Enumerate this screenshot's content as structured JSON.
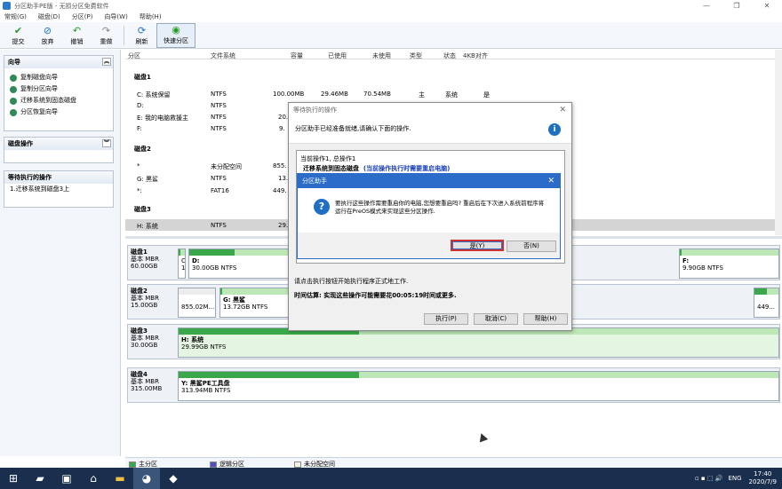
{
  "window": {
    "title": "分区助手PE版 - 无损分区免费软件",
    "controls": [
      "—",
      "❐",
      "✕"
    ]
  },
  "menu": [
    "常规(G)",
    "磁盘(D)",
    "分区(P)",
    "向导(W)",
    "帮助(H)"
  ],
  "toolbar": [
    {
      "label": "提交",
      "icon": "check-icon"
    },
    {
      "label": "放弃",
      "icon": "discard-icon"
    },
    {
      "label": "撤销",
      "icon": "undo-icon"
    },
    {
      "label": "重做",
      "icon": "redo-icon"
    },
    {
      "label": "刷新",
      "icon": "refresh-icon"
    },
    {
      "label": "快速分区",
      "icon": "quick-partition-icon"
    }
  ],
  "sidebar": {
    "wizard": {
      "title": "向导",
      "items": [
        "复制磁盘向导",
        "复制分区向导",
        "迁移系统到固态磁盘",
        "分区恢复向导"
      ]
    },
    "disk_ops": {
      "title": "磁盘操作"
    },
    "pending": {
      "title": "等待执行的操作",
      "items": [
        "1.迁移系统到磁盘3上"
      ]
    }
  },
  "columns": [
    "分区",
    "文件系统",
    "容量",
    "已使用",
    "未使用",
    "类型",
    "状态",
    "4KB对齐"
  ],
  "disks": [
    {
      "name": "磁盘1",
      "rows": [
        {
          "part": "C: 系统保留",
          "fs": "NTFS",
          "cap": "100.00MB",
          "used": "29.46MB",
          "free": "70.54MB",
          "type": "主",
          "status": "系统",
          "align": "是"
        },
        {
          "part": "D:",
          "fs": "NTFS",
          "cap": "",
          "used": "",
          "free": "",
          "type": "",
          "status": "",
          "align": ""
        },
        {
          "part": "E: 我的电脑救援主",
          "fs": "NTFS",
          "cap": "20.",
          "used": "",
          "free": "",
          "type": "",
          "status": "",
          "align": ""
        },
        {
          "part": "F:",
          "fs": "NTFS",
          "cap": "9.",
          "used": "",
          "free": "",
          "type": "",
          "status": "",
          "align": ""
        }
      ]
    },
    {
      "name": "磁盘2",
      "rows": [
        {
          "part": "*",
          "fs": "未分配空间",
          "cap": "855.",
          "used": "",
          "free": "",
          "type": "",
          "status": "",
          "align": ""
        },
        {
          "part": "G: 黑鲨",
          "fs": "NTFS",
          "cap": "13.",
          "used": "",
          "free": "",
          "type": "",
          "status": "",
          "align": ""
        },
        {
          "part": "*:",
          "fs": "FAT16",
          "cap": "449.",
          "used": "",
          "free": "",
          "type": "",
          "status": "",
          "align": ""
        }
      ]
    },
    {
      "name": "磁盘3",
      "rows": [
        {
          "part": "H: 系统",
          "fs": "NTFS",
          "cap": "29.",
          "used": "",
          "free": "",
          "type": "",
          "status": "",
          "align": ""
        }
      ]
    }
  ],
  "diskmap": [
    {
      "name": "磁盘1",
      "type": "基本 MBR",
      "size": "60.00GB",
      "parts": [
        {
          "label": "C",
          "sub": "1",
          "used": 0.3
        },
        {
          "label": "D:",
          "sub": "30.00GB NTFS",
          "used": 0.45
        },
        {
          "label": "F:",
          "sub": "9.90GB NTFS",
          "used": 0.02
        }
      ]
    },
    {
      "name": "磁盘2",
      "type": "基本 MBR",
      "size": "15.00GB",
      "parts": [
        {
          "label": "",
          "sub": "855.02M...",
          "used": 0
        },
        {
          "label": "G: 黑鲨",
          "sub": "13.72GB NTFS",
          "used": 0.02
        },
        {
          "label": "",
          "sub": "449...",
          "used": 0.5
        }
      ]
    },
    {
      "name": "磁盘3",
      "type": "基本 MBR",
      "size": "30.00GB",
      "parts": [
        {
          "label": "H: 系统",
          "sub": "29.99GB NTFS",
          "used": 0.3
        }
      ]
    },
    {
      "name": "磁盘4",
      "type": "基本 MBR",
      "size": "315.00MB",
      "parts": [
        {
          "label": "Y: 黑鲨PE工具盘",
          "sub": "313.94MB NTFS",
          "used": 0.3
        }
      ]
    }
  ],
  "legend": [
    "主分区",
    "逻辑分区",
    "未分配空间"
  ],
  "legend_colors": [
    "#3aa84a",
    "#5050c0",
    "#f4f0e0"
  ],
  "pending_dialog": {
    "title": "等待执行的操作",
    "header": "分区助手已经准备就绪,请确认下面的操作.",
    "current": "当前操作1, 总操作1",
    "op": "迁移系统到固态磁盘",
    "op_note": "(当前操作执行时需要重启电脑)",
    "hint": "请点击执行按钮开始执行程序正式地工作.",
    "time": "时间估算: 实现这些操作可能需要花00:05:19时间或更多.",
    "buttons": [
      "执行(P)",
      "取消(C)",
      "帮助(H)"
    ]
  },
  "confirm_dialog": {
    "title": "分区助手",
    "message": "要执行这些操作需要重启你的电脑,您想要重启吗? 重启后在下次进入系统前程序将运行在PreOS模式来实现这些分区操作.",
    "yes": "是(Y)",
    "no": "否(N)"
  },
  "taskbar": {
    "lang": "ENG",
    "time": "17:40",
    "date": "2020/7/9"
  }
}
